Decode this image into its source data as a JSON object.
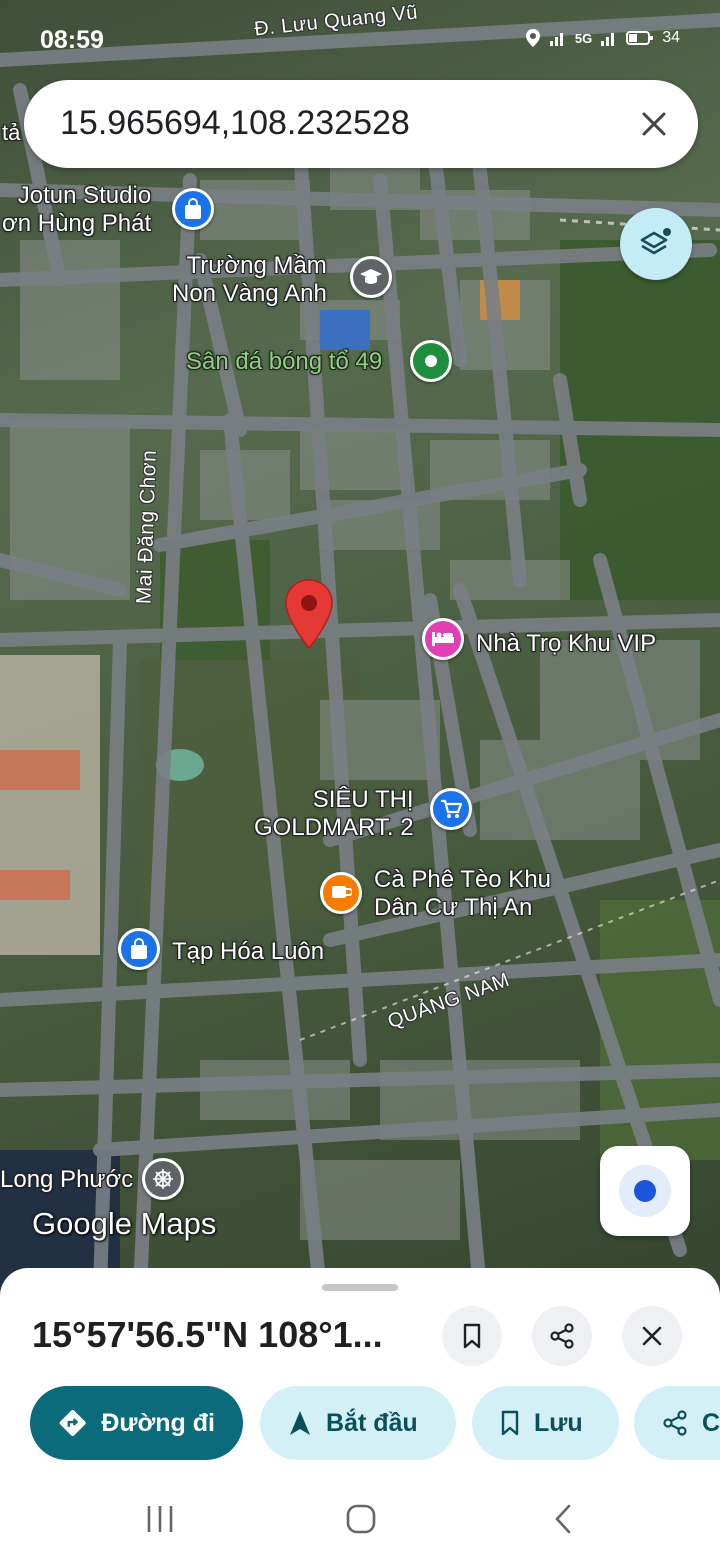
{
  "status_bar": {
    "time": "08:59",
    "network": "5G",
    "battery": "34"
  },
  "search": {
    "query": "15.965694,108.232528"
  },
  "map_labels": {
    "road_luu_quang_vu": "Đ. Lưu Quang Vũ",
    "road_mai_dang_chon": "Mai Đăng Chơn",
    "road_quang_nam": "QUẢNG NAM",
    "edge_fragment": "tả",
    "jotun_studio": "Jotun Studio\nơn Hùng Phát",
    "truong_mam_non": "Trường Mầm\nNon Vàng Anh",
    "san_da_bong": "Sân đá bóng tổ 49",
    "nha_tro": "Nhà Trọ Khu VIP",
    "sieu_thi": "SIÊU THỊ\nGOLDMART. 2",
    "ca_phe": "Cà Phê Tèo Khu\nDân Cư Thị An",
    "tap_hoa": "Tạp Hóa Luôn",
    "long_phuoc": "Long Phước",
    "google_maps_logo": "Google Maps"
  },
  "place_sheet": {
    "title": "15°57'56.5\"N 108°1...",
    "chips": {
      "directions": "Đường đi",
      "start": "Bắt đầu",
      "save": "Lưu",
      "share_partial": "C"
    }
  },
  "colors": {
    "primary_chip": "#0b6b7b",
    "tonal_chip": "#d3f0f7",
    "pin_red": "#e53935",
    "poi_blue": "#1a73e8",
    "poi_green": "#1e8e3e",
    "poi_pink": "#e040b4",
    "poi_orange": "#f57c00",
    "poi_gray": "#5f6368"
  }
}
